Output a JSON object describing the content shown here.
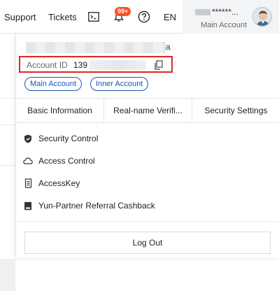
{
  "topbar": {
    "support": "Support",
    "tickets": "Tickets",
    "badge": "99+",
    "lang": "EN",
    "account_name_tail": "******...",
    "account_role": "Main Account"
  },
  "dropdown": {
    "name_tail": "a",
    "account_id_label": "Account ID",
    "account_id_value": "139",
    "tags": [
      "Main Account",
      "Inner Account"
    ],
    "tabs": [
      "Basic Information",
      "Real-name Verifi...",
      "Security Settings"
    ],
    "menu": [
      {
        "label": "Security Control",
        "icon": "shield-icon"
      },
      {
        "label": "Access Control",
        "icon": "cloud-icon"
      },
      {
        "label": "AccessKey",
        "icon": "key-icon"
      },
      {
        "label": "Yun-Partner Referral Cashback",
        "icon": "book-icon"
      }
    ],
    "logout": "Log Out"
  }
}
